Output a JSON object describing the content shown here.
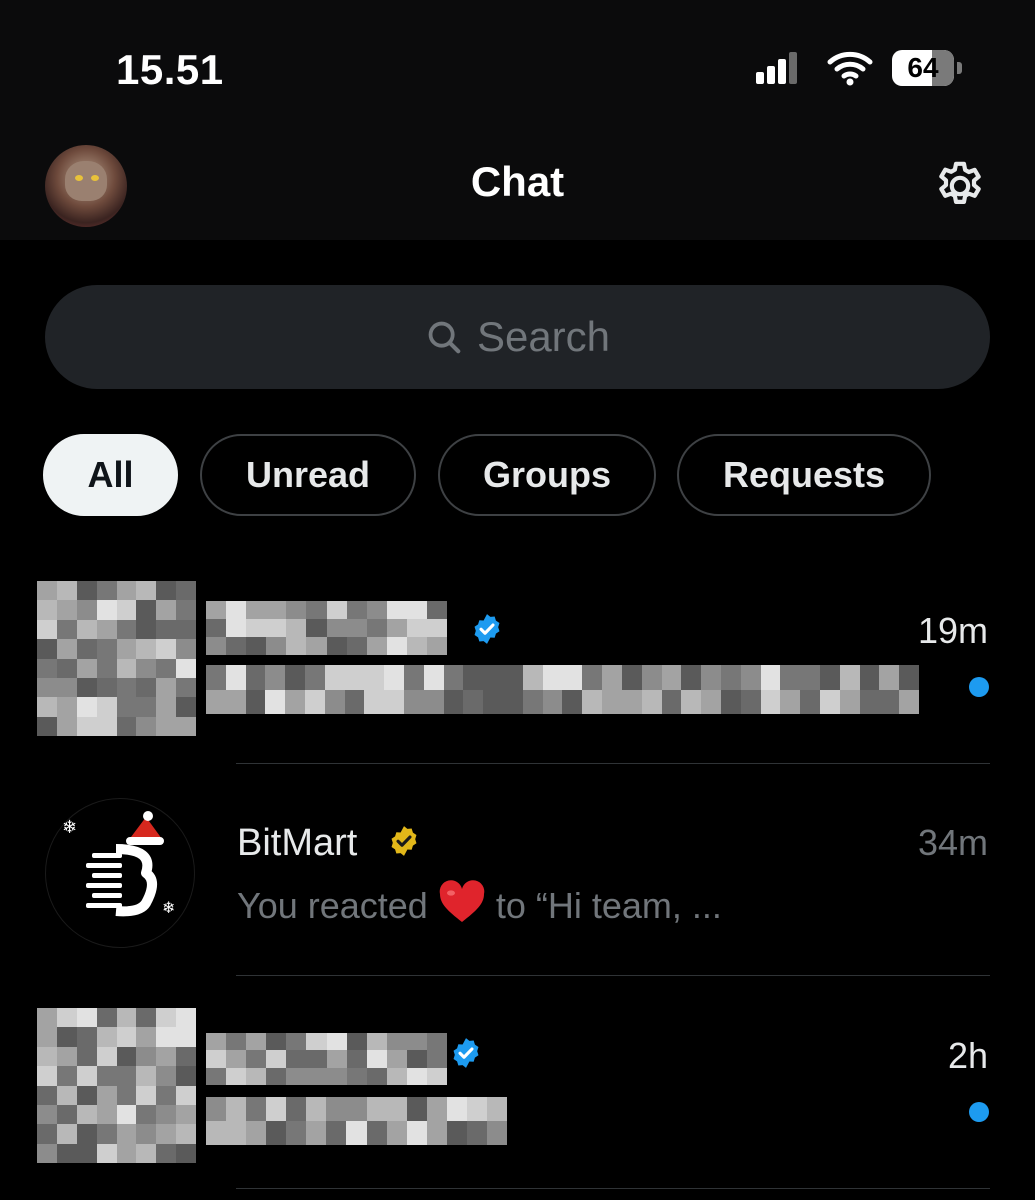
{
  "status_bar": {
    "time": "15.51",
    "battery": "64"
  },
  "header": {
    "title": "Chat"
  },
  "search": {
    "placeholder": "Search"
  },
  "filters": [
    {
      "label": "All",
      "active": true
    },
    {
      "label": "Unread",
      "active": false
    },
    {
      "label": "Groups",
      "active": false
    },
    {
      "label": "Requests",
      "active": false
    }
  ],
  "conversations": [
    {
      "name": "",
      "name_redacted": true,
      "verified": "blue",
      "time": "19m",
      "unread": true,
      "preview": "",
      "preview_redacted": true
    },
    {
      "name": "BitMart",
      "verified": "gold",
      "time": "34m",
      "unread": false,
      "preview_before": "You reacted",
      "preview_after": "to “Hi team, ..."
    },
    {
      "name": "",
      "name_redacted": true,
      "verified": "blue",
      "time": "2h",
      "unread": true,
      "preview": "",
      "preview_redacted": true
    }
  ],
  "colors": {
    "accent_blue": "#1d9bf0",
    "gold": "#e2b719",
    "muted": "#71767b",
    "background": "#000000"
  },
  "icons": {
    "settings": "gear-icon",
    "search": "search-icon",
    "verified": "verified-badge-icon",
    "heart": "heart-emoji-icon"
  }
}
